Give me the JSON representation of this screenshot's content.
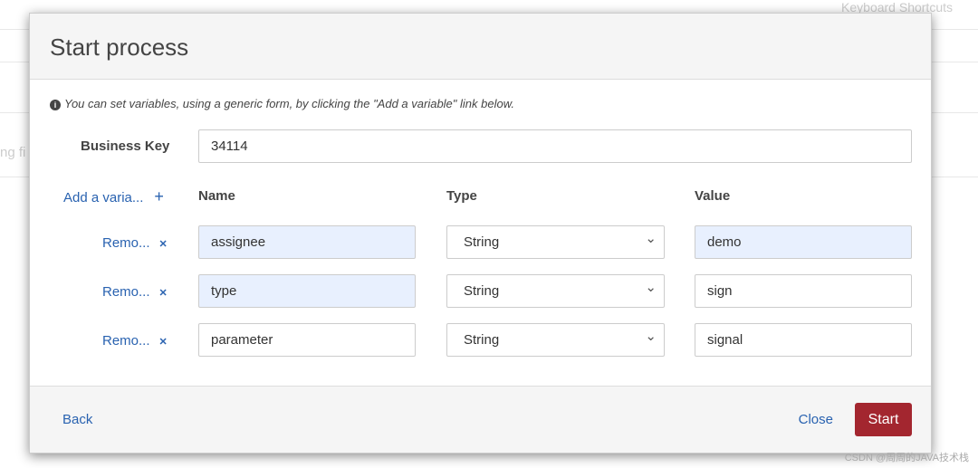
{
  "background": {
    "keyboard_shortcuts": "Keyboard Shortcuts",
    "fragment": "ng fi"
  },
  "modal": {
    "title": "Start process",
    "info": "You can set variables, using a generic form, by clicking the \"Add a variable\" link below.",
    "business_key_label": "Business Key",
    "business_key": "34114",
    "add_variable": "Add a varia...",
    "headers": {
      "name": "Name",
      "type": "Type",
      "value": "Value"
    },
    "variables": [
      {
        "remove": "Remo...",
        "name": "assignee",
        "type": "String",
        "value": "demo"
      },
      {
        "remove": "Remo...",
        "name": "type",
        "type": "String",
        "value": "sign"
      },
      {
        "remove": "Remo...",
        "name": "parameter",
        "type": "String",
        "value": "signal"
      }
    ],
    "back": "Back",
    "close": "Close",
    "start": "Start"
  },
  "watermark": "CSDN @周周的JAVA技术栈",
  "colors": {
    "primary": "#a3262f",
    "link": "#2962b0"
  }
}
